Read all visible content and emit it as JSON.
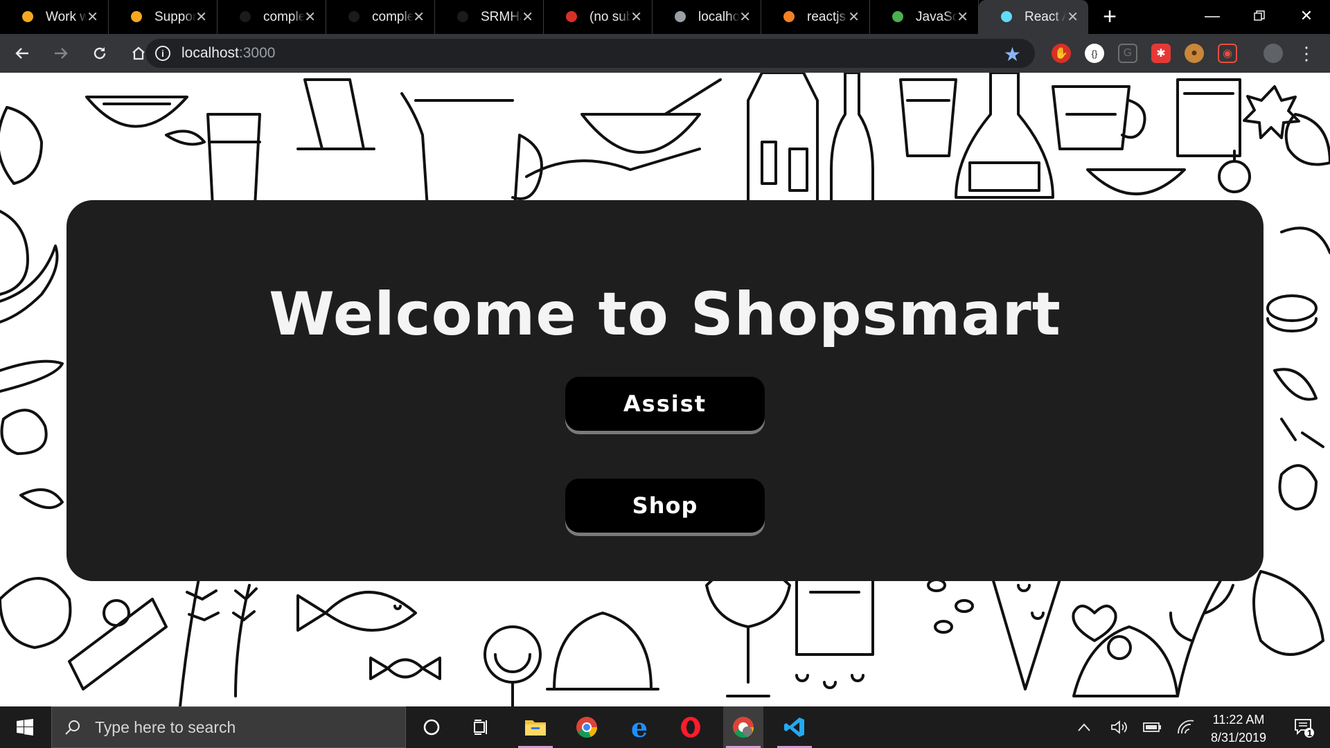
{
  "browser": {
    "tabs": [
      {
        "title": "Work w",
        "favicon": "firebase-icon",
        "color": "#f6a821"
      },
      {
        "title": "Support",
        "favicon": "firebase-icon",
        "color": "#f6a821"
      },
      {
        "title": "comple",
        "favicon": "github-icon",
        "color": "#1b1b1b"
      },
      {
        "title": "comple",
        "favicon": "github-icon",
        "color": "#1b1b1b"
      },
      {
        "title": "SRMHa",
        "favicon": "github-icon",
        "color": "#1b1b1b"
      },
      {
        "title": "(no sub",
        "favicon": "gmail-icon",
        "color": "#d93025"
      },
      {
        "title": "localhos",
        "favicon": "globe-icon",
        "color": "#9aa0a6"
      },
      {
        "title": "reactjs",
        "favicon": "stackoverflow-icon",
        "color": "#f48024"
      },
      {
        "title": "JavaScr",
        "favicon": "w3schools-icon",
        "color": "#4caf50"
      },
      {
        "title": "React A",
        "favicon": "react-icon",
        "color": "#61dafb"
      }
    ],
    "active_tab_index": 9,
    "address": {
      "host": "localhost",
      "port": ":3000"
    }
  },
  "page": {
    "heading": "Welcome to Shopsmart",
    "assist_label": "Assist",
    "shop_label": "Shop"
  },
  "taskbar": {
    "search_placeholder": "Type here to search",
    "time": "11:22 AM",
    "date": "8/31/2019",
    "notification_count": "1"
  },
  "colors": {
    "card": "#1e1e1e",
    "button": "#000000",
    "accent_star": "#8ab4f8"
  }
}
